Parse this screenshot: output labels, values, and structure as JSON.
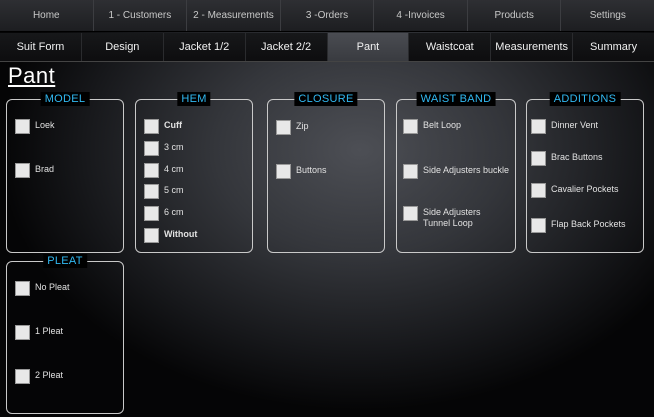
{
  "top_nav": [
    "Home",
    "1 - Customers",
    "2 - Measurements",
    "3 -Orders",
    "4 -Invoices",
    "Products",
    "Settings"
  ],
  "tabs": [
    "Suit Form",
    "Design",
    "Jacket 1/2",
    "Jacket 2/2",
    "Pant",
    "Waistcoat",
    "Measurements",
    "Summary"
  ],
  "active_tab": "Pant",
  "page_title": "Pant",
  "accent_color": "#31b9f2",
  "panels": {
    "model": {
      "title": "MODEL",
      "options": [
        "Loek",
        "Brad"
      ]
    },
    "hem": {
      "title": "HEM",
      "options": [
        "Cuff",
        "3 cm",
        "4 cm",
        "5 cm",
        "6 cm",
        "Without"
      ]
    },
    "closure": {
      "title": "CLOSURE",
      "options": [
        "Zip",
        "Buttons"
      ]
    },
    "waist_band": {
      "title": "WAIST BAND",
      "options": [
        "Belt Loop",
        "Side Adjusters buckle",
        "Side Adjusters\nTunnel Loop"
      ]
    },
    "additions": {
      "title": "ADDITIONS",
      "options": [
        "Dinner Vent",
        "Brac Buttons",
        "Cavalier Pockets",
        "Flap Back Pockets"
      ]
    },
    "pleat": {
      "title": "PLEAT",
      "options": [
        "No Pleat",
        "1 Pleat",
        "2 Pleat"
      ]
    }
  }
}
